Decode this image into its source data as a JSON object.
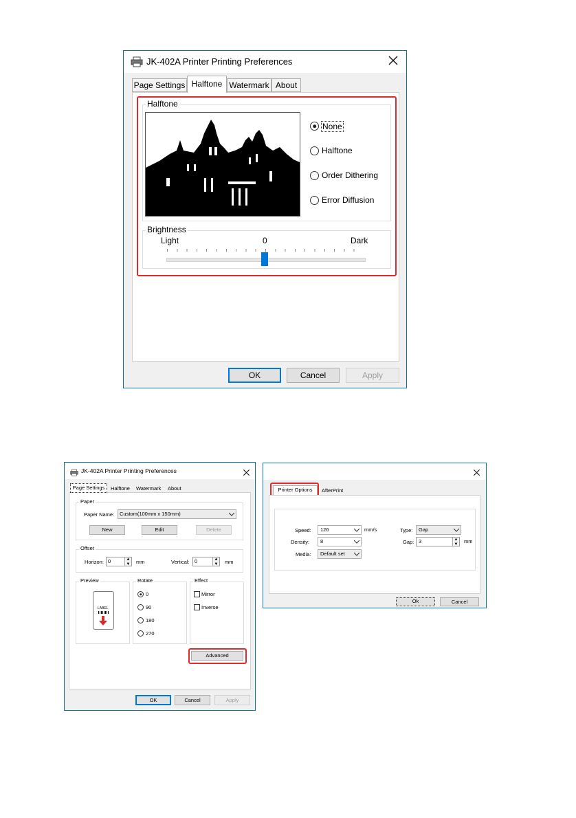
{
  "colors": {
    "window_border": "#0e6fb0",
    "highlight": "#e0292d",
    "default_button": "#0078d7",
    "slider_thumb": "#0078d7"
  },
  "icons": {
    "printer": "printer-icon",
    "close": "close-icon"
  },
  "top_dialog": {
    "title": "JK-402A Printer Printing Preferences",
    "tabs": [
      "Page Settings",
      "Halftone",
      "Watermark",
      "About"
    ],
    "active_tab": "Halftone",
    "halftone_group_label": "Halftone",
    "options": [
      "None",
      "Halftone",
      "Order Dithering",
      "Error Diffusion"
    ],
    "selected_option": "None",
    "brightness": {
      "label": "Brightness",
      "light": "Light",
      "value": "0",
      "dark": "Dark",
      "level": 0.5
    },
    "buttons": {
      "ok": "OK",
      "cancel": "Cancel",
      "apply": "Apply"
    }
  },
  "left_dialog": {
    "title": "JK-402A Printer Printing Preferences",
    "tabs": [
      "Page Settings",
      "Halftone",
      "Watermark",
      "About"
    ],
    "active_tab": "Page Settings",
    "paper": {
      "label": "Paper",
      "name_label": "Paper Name:",
      "name_value": "Custom(100mm x 150mm)",
      "new": "New",
      "edit": "Edit",
      "delete": "Delete"
    },
    "offset": {
      "label": "Offset",
      "horizon_label": "Horizon:",
      "horizon_value": "0",
      "horizon_unit": "mm",
      "vertical_label": "Vertical:",
      "vertical_value": "0",
      "vertical_unit": "mm"
    },
    "preview": {
      "label": "Preview",
      "card_text": "LABEL"
    },
    "rotate": {
      "label": "Rotate",
      "options": [
        "0",
        "90",
        "180",
        "270"
      ],
      "selected": "0"
    },
    "effect": {
      "label": "Effect",
      "mirror": "Mirror",
      "inverse": "Inverse"
    },
    "advanced": "Advanced",
    "buttons": {
      "ok": "OK",
      "cancel": "Cancel",
      "apply": "Apply"
    }
  },
  "right_dialog": {
    "tabs": [
      "Printer Options",
      "AfterPrint"
    ],
    "active_tab": "Printer Options",
    "speed_label": "Speed:",
    "speed_value": "126",
    "speed_unit": "mm/s",
    "density_label": "Density:",
    "density_value": "8",
    "media_label": "Media:",
    "media_value": "Default set",
    "type_label": "Type:",
    "type_value": "Gap",
    "gap_label": "Gap:",
    "gap_value": "3",
    "gap_unit": "mm",
    "buttons": {
      "ok": "Ok",
      "cancel": "Cancel"
    }
  }
}
